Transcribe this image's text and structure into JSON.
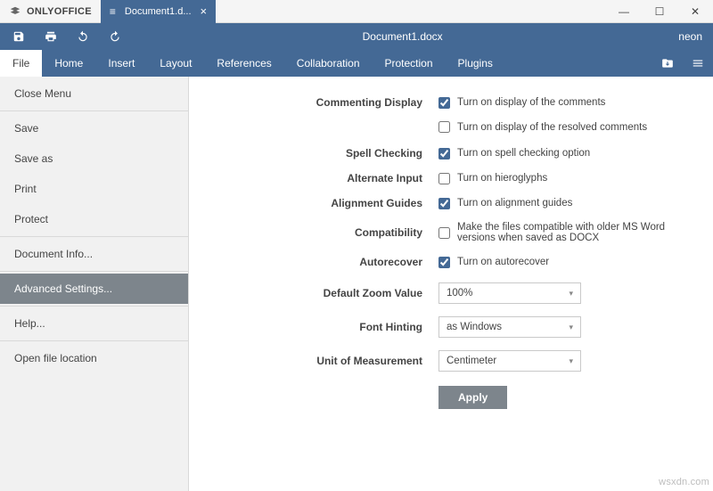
{
  "app": {
    "brand": "ONLYOFFICE",
    "tab_label": "Document1.d...",
    "user": "neon",
    "doc_title": "Document1.docx"
  },
  "menus": {
    "file": "File",
    "home": "Home",
    "insert": "Insert",
    "layout": "Layout",
    "references": "References",
    "collaboration": "Collaboration",
    "protection": "Protection",
    "plugins": "Plugins"
  },
  "sidebar": {
    "close_menu": "Close Menu",
    "save": "Save",
    "save_as": "Save as",
    "print": "Print",
    "protect": "Protect",
    "doc_info": "Document Info...",
    "advanced": "Advanced Settings...",
    "help": "Help...",
    "open_loc": "Open file location"
  },
  "settings": {
    "commenting_label": "Commenting Display",
    "commenting_opt1": "Turn on display of the comments",
    "commenting_opt2": "Turn on display of the resolved comments",
    "spell_label": "Spell Checking",
    "spell_opt": "Turn on spell checking option",
    "altinput_label": "Alternate Input",
    "altinput_opt": "Turn on hieroglyphs",
    "align_label": "Alignment Guides",
    "align_opt": "Turn on alignment guides",
    "compat_label": "Compatibility",
    "compat_opt": "Make the files compatible with older MS Word versions when saved as DOCX",
    "autorec_label": "Autorecover",
    "autorec_opt": "Turn on autorecover",
    "zoom_label": "Default Zoom Value",
    "zoom_value": "100%",
    "hint_label": "Font Hinting",
    "hint_value": "as Windows",
    "unit_label": "Unit of Measurement",
    "unit_value": "Centimeter",
    "apply": "Apply"
  },
  "watermark": "wsxdn.com"
}
